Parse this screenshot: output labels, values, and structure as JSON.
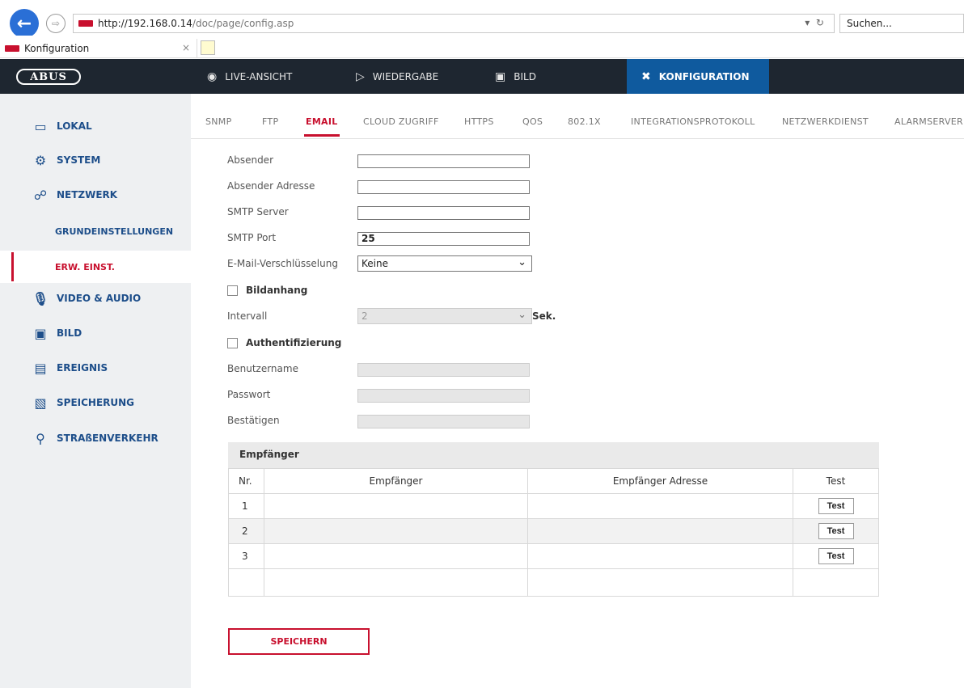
{
  "browser": {
    "url_host": "http://192.168.0.14",
    "url_path": "/doc/page/config.asp",
    "search_placeholder": "Suchen...",
    "tab_title": "Konfiguration"
  },
  "topnav": {
    "logo": "ABUS",
    "items": [
      {
        "label": "LIVE-ANSICHT",
        "icon": "eye-icon"
      },
      {
        "label": "WIEDERGABE",
        "icon": "play-icon"
      },
      {
        "label": "BILD",
        "icon": "image-icon"
      },
      {
        "label": "KONFIGURATION",
        "icon": "tools-icon",
        "active": true
      }
    ]
  },
  "sidebar": {
    "items": [
      {
        "label": "LOKAL",
        "icon": "monitor-icon"
      },
      {
        "label": "SYSTEM",
        "icon": "gear-icon"
      },
      {
        "label": "NETZWERK",
        "icon": "network-icon"
      },
      {
        "label": "GRUNDEINSTELLUNGEN",
        "sub": true
      },
      {
        "label": "ERW. EINST.",
        "sub": true,
        "active": true
      },
      {
        "label": "VIDEO & AUDIO",
        "icon": "microphone-icon"
      },
      {
        "label": "BILD",
        "icon": "image-icon"
      },
      {
        "label": "EREIGNIS",
        "icon": "calendar-icon"
      },
      {
        "label": "SPEICHERUNG",
        "icon": "floppy-icon"
      },
      {
        "label": "STRAßENVERKEHR",
        "icon": "car-search-icon"
      }
    ]
  },
  "subtabs": [
    "SNMP",
    "FTP",
    "EMAIL",
    "CLOUD ZUGRIFF",
    "HTTPS",
    "QOS",
    "802.1X",
    "INTEGRATIONSPROTOKOLL",
    "NETZWERKDIENST",
    "ALARMSERVER"
  ],
  "form": {
    "absender_label": "Absender",
    "absender_value": "",
    "absender_adresse_label": "Absender Adresse",
    "absender_adresse_value": "",
    "smtp_server_label": "SMTP Server",
    "smtp_server_value": "",
    "smtp_port_label": "SMTP Port",
    "smtp_port_value": "25",
    "encryption_label": "E-Mail-Verschlüsselung",
    "encryption_value": "Keine",
    "bildanhang_label": "Bildanhang",
    "intervall_label": "Intervall",
    "intervall_value": "2",
    "intervall_unit": "Sek.",
    "auth_label": "Authentifizierung",
    "benutzername_label": "Benutzername",
    "passwort_label": "Passwort",
    "bestaetigen_label": "Bestätigen"
  },
  "recipients": {
    "header": "Empfänger",
    "columns": [
      "Nr.",
      "Empfänger",
      "Empfänger Adresse",
      "Test"
    ],
    "rows": [
      {
        "nr": "1",
        "name": "",
        "address": "",
        "test": "Test"
      },
      {
        "nr": "2",
        "name": "",
        "address": "",
        "test": "Test"
      },
      {
        "nr": "3",
        "name": "",
        "address": "",
        "test": "Test"
      }
    ]
  },
  "save_label": "SPEICHERN",
  "colors": {
    "accent": "#c8102e",
    "nav_bg": "#1e2630",
    "nav_active": "#0f5a9e",
    "sidebar_text": "#1d4e8a"
  }
}
